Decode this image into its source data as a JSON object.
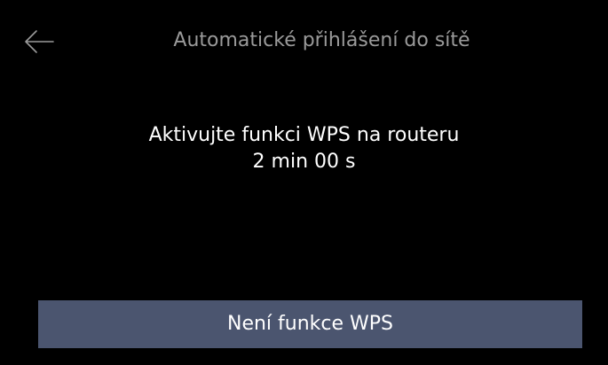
{
  "header": {
    "back_icon": "arrow-left-icon",
    "title": "Automatické přihlášení do sítě"
  },
  "main": {
    "instruction": "Aktivujte funkci WPS na routeru",
    "countdown": "2 min 00 s"
  },
  "footer": {
    "no_wps_label": "Není funkce WPS"
  },
  "colors": {
    "background": "#000000",
    "title_text": "#9a9a9a",
    "primary_text": "#ffffff",
    "button_background": "#4b556f"
  }
}
